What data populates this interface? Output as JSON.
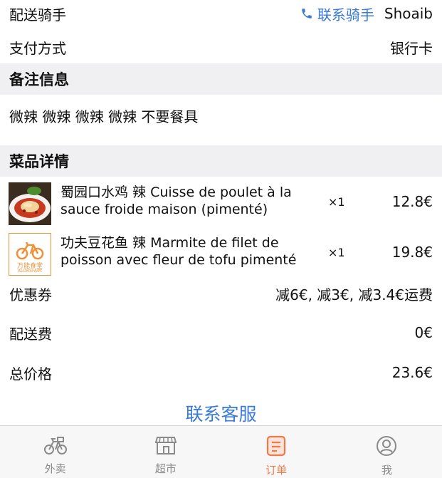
{
  "rider": {
    "label": "配送骑手",
    "contact_label": "联系骑手",
    "name": "Shoaib"
  },
  "payment": {
    "label": "支付方式",
    "value": "银行卡"
  },
  "remarks": {
    "header": "备注信息",
    "text": "微辣 微辣 微辣 微辣 不要餐具"
  },
  "dishes": {
    "header": "菜品详情",
    "items": [
      {
        "name": "蜀园口水鸡  辣 Cuisse de poulet à la sauce froide maison (pimenté)",
        "qty": "×1",
        "price": "12.8€",
        "image": "chicken-dish-photo"
      },
      {
        "name": "功夫豆花鱼  辣 Marmite de filet de poisson avec fleur de tofu pimenté",
        "qty": "×1",
        "price": "19.8€",
        "image": "restaurant-logo",
        "logo_text": "万能食堂",
        "logo_subtext": "ALORSFAIM"
      }
    ]
  },
  "coupon": {
    "label": "优惠券",
    "value": "减6€, 减3€, 减3.4€运费"
  },
  "delivery_fee": {
    "label": "配送费",
    "value": "0€"
  },
  "total": {
    "label": "总价格",
    "value": "23.6€"
  },
  "customer_service": {
    "label": "联系客服"
  },
  "tabs": [
    {
      "label": "外卖",
      "icon": "bike-icon",
      "active": false
    },
    {
      "label": "超市",
      "icon": "store-icon",
      "active": false
    },
    {
      "label": "订单",
      "icon": "order-icon",
      "active": true
    },
    {
      "label": "我",
      "icon": "profile-icon",
      "active": false
    }
  ],
  "colors": {
    "accent_blue": "#3a7ad3",
    "active_tab": "#ee7a4a",
    "section_bg": "#f0f0f2",
    "logo_orange": "#f0913a"
  }
}
